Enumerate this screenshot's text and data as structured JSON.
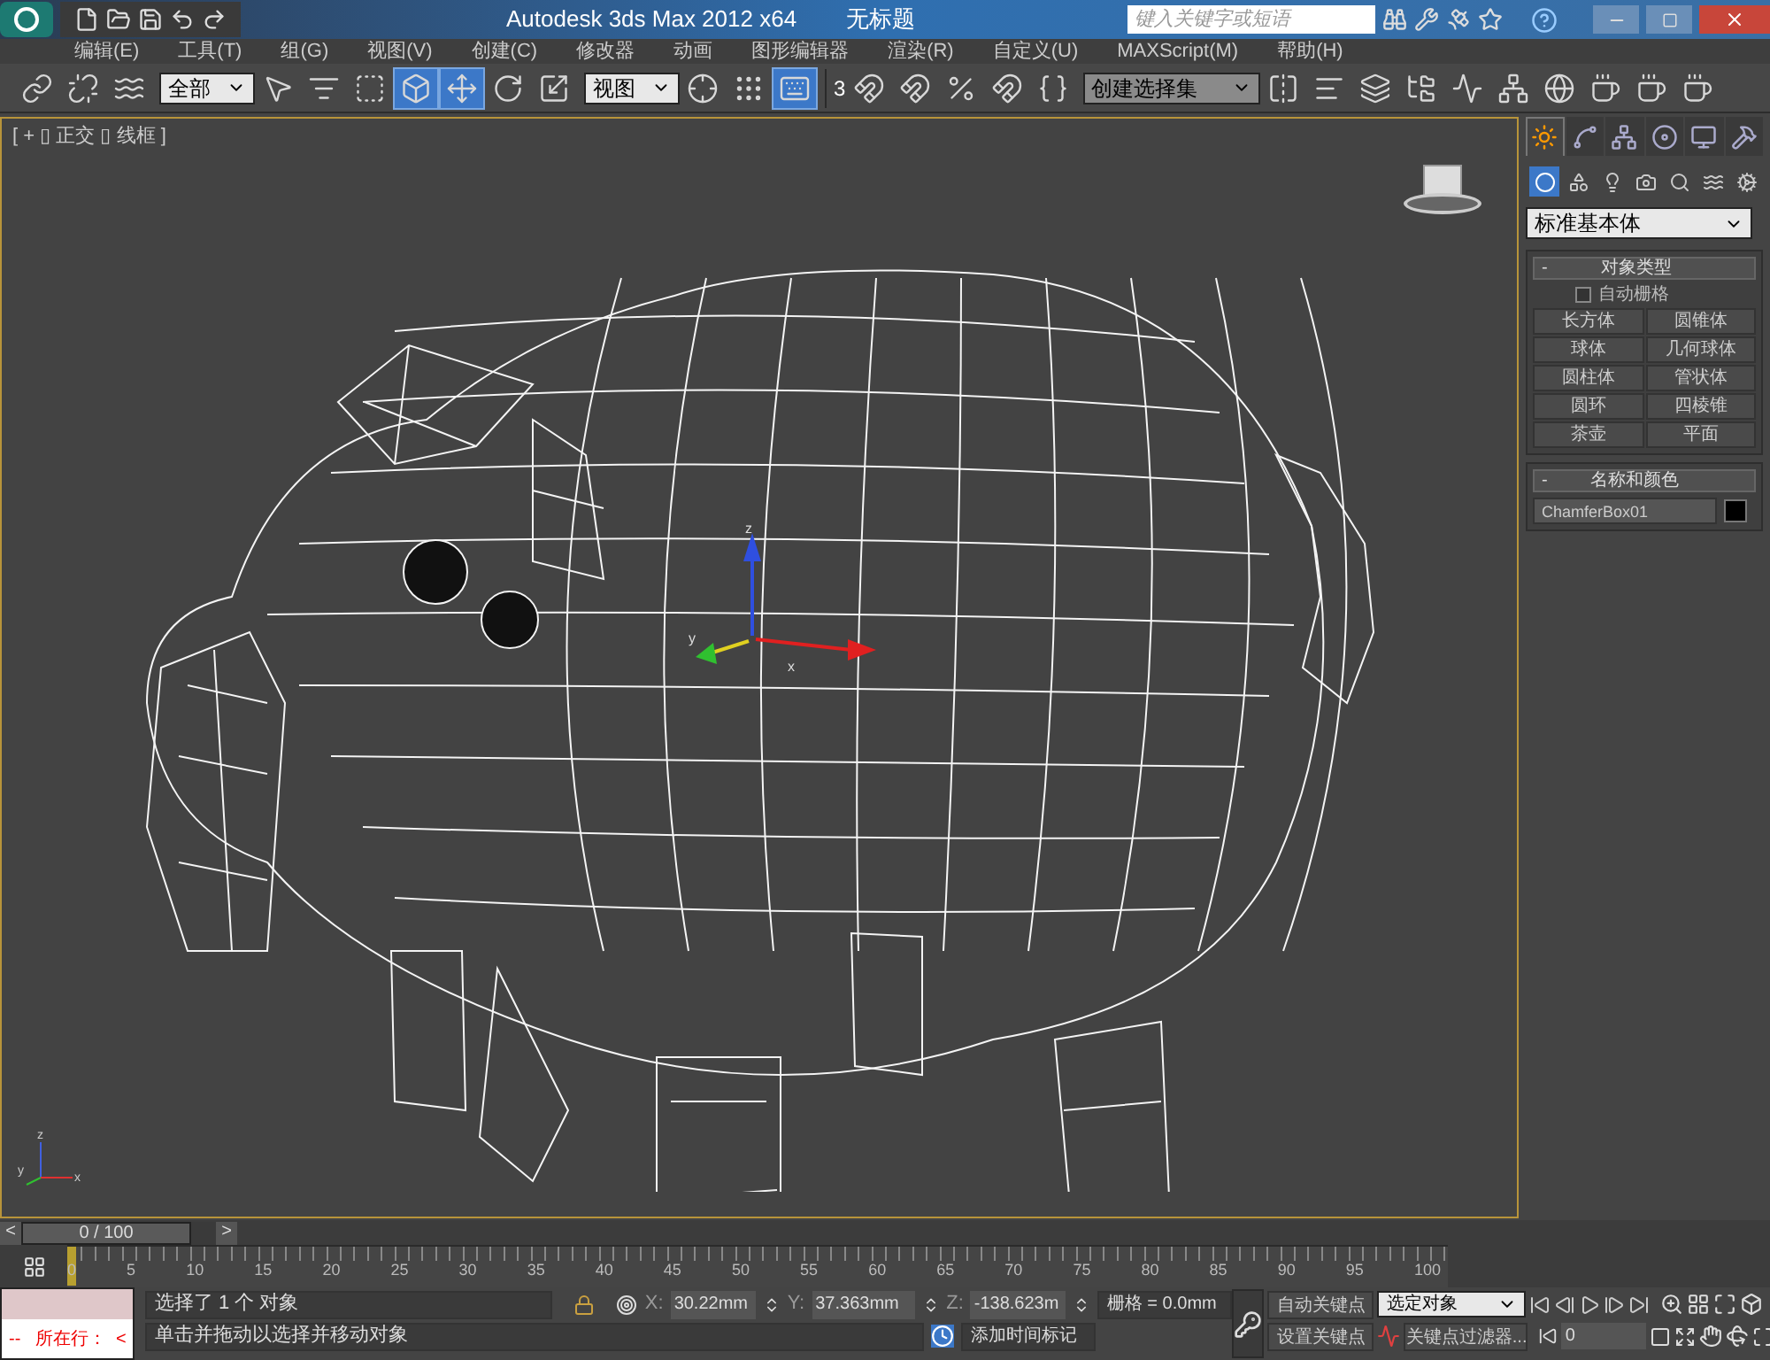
{
  "title_bar": {
    "quick_tools": [
      {
        "kind": "new"
      },
      {
        "kind": "open"
      },
      {
        "kind": "save"
      },
      {
        "kind": "undo"
      },
      {
        "kind": "redo"
      }
    ],
    "app_title": "Autodesk 3ds Max  2012 x64",
    "document": "无标题",
    "search": {
      "placeholder": "键入关键字或短语"
    }
  },
  "menu": [
    "编辑(E)",
    "工具(T)",
    "组(G)",
    "视图(V)",
    "创建(C)",
    "修改器",
    "动画",
    "图形编辑器",
    "渲染(R)",
    "自定义(U)",
    "MAXScript(M)",
    "帮助(H)"
  ],
  "toolbar": {
    "tools_a": [
      {
        "kind": "link",
        "selected": false
      },
      {
        "kind": "unlink",
        "selected": false
      },
      {
        "kind": "bind",
        "selected": false
      }
    ],
    "selection_filter": "全部",
    "tools_b": [
      {
        "kind": "select",
        "selected": false
      },
      {
        "kind": "select-by-name",
        "selected": false
      },
      {
        "kind": "region",
        "selected": false
      },
      {
        "kind": "window",
        "selected": true
      },
      {
        "kind": "move",
        "selected": true
      },
      {
        "kind": "rotate",
        "selected": false
      },
      {
        "kind": "scale",
        "selected": false
      }
    ],
    "reference_coord": "视图",
    "tools_c": [
      {
        "kind": "pivot",
        "selected": false
      },
      {
        "kind": "manipulate",
        "selected": false
      },
      {
        "kind": "keyboard",
        "selected": true
      }
    ],
    "snap_label": "3",
    "tools_d": [
      {
        "kind": "snap",
        "selected": false
      },
      {
        "kind": "angle-snap",
        "selected": false
      },
      {
        "kind": "percent-snap",
        "selected": false
      },
      {
        "kind": "spinner-snap",
        "selected": false
      },
      {
        "kind": "edit-named",
        "selected": false
      }
    ],
    "named_selection": "创建选择集",
    "tools_e": [
      {
        "kind": "mirror",
        "selected": false
      },
      {
        "kind": "align",
        "selected": false
      },
      {
        "kind": "layers",
        "selected": false
      },
      {
        "kind": "explorer",
        "selected": false
      },
      {
        "kind": "curve",
        "selected": false
      },
      {
        "kind": "schematic",
        "selected": false
      },
      {
        "kind": "material",
        "selected": false
      },
      {
        "kind": "render-setup",
        "selected": false
      },
      {
        "kind": "render-frame",
        "selected": false
      },
      {
        "kind": "render",
        "selected": false
      }
    ]
  },
  "viewport": {
    "label": "[ + ▯ 正交 ▯ 线框 ]",
    "gizmo_axes": [
      "x",
      "y",
      "z"
    ],
    "corner_axes": [
      "x",
      "y",
      "z"
    ]
  },
  "command_panel": {
    "tabs": [
      {
        "kind": "create",
        "selected": true
      },
      {
        "kind": "modify",
        "selected": false
      },
      {
        "kind": "hierarchy",
        "selected": false
      },
      {
        "kind": "motion",
        "selected": false
      },
      {
        "kind": "display",
        "selected": false
      },
      {
        "kind": "utilities",
        "selected": false
      }
    ],
    "categories": [
      {
        "kind": "geometry",
        "selected": true
      },
      {
        "kind": "shapes",
        "selected": false
      },
      {
        "kind": "lights",
        "selected": false
      },
      {
        "kind": "cameras",
        "selected": false
      },
      {
        "kind": "helpers",
        "selected": false
      },
      {
        "kind": "spacewarps",
        "selected": false
      },
      {
        "kind": "systems",
        "selected": false
      }
    ],
    "dropdown": "标准基本体",
    "object_type": {
      "title": "对象类型",
      "toggle": "-",
      "autogrid": {
        "label": "自动栅格",
        "checked": false
      },
      "buttons": [
        "长方体",
        "圆锥体",
        "球体",
        "几何球体",
        "圆柱体",
        "管状体",
        "圆环",
        "四棱锥",
        "茶壶",
        "平面"
      ]
    },
    "name_color": {
      "title": "名称和颜色",
      "toggle": "-",
      "name": "ChamferBox01",
      "color": "#000000"
    }
  },
  "timeline": {
    "prev": "<",
    "frame": "0 / 100",
    "next": ">",
    "level": 0,
    "ticks": [
      "0",
      "5",
      "10",
      "15",
      "20",
      "25",
      "30",
      "35",
      "40",
      "45",
      "50",
      "55",
      "60",
      "65",
      "70",
      "75",
      "80",
      "85",
      "90",
      "95",
      "100"
    ]
  },
  "status": {
    "listener": "--   所在行：  <",
    "selection": "选择了 1 个 对象",
    "prompt": "单击并拖动以选择并移动对象",
    "x_label": "X:",
    "x": "30.22mm",
    "y_label": "Y:",
    "y": "37.363mm",
    "z_label": "Z:",
    "z": "-138.623m",
    "grid": "栅格 = 0.0mm",
    "time_tag": "添加时间标记",
    "auto_key": "自动关键点",
    "set_key": "设置关键点",
    "key_mode": "选定对象",
    "key_filters": "关键点过滤器...",
    "frame_field": "0"
  }
}
